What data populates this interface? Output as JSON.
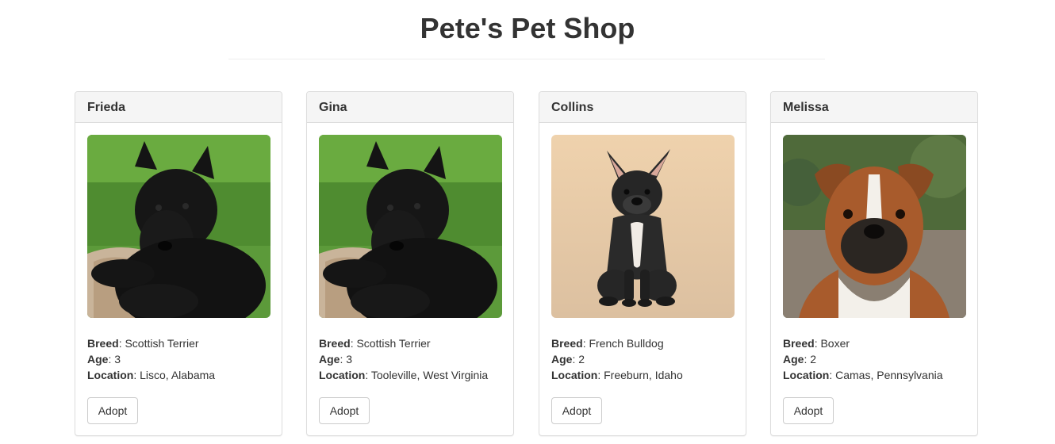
{
  "header": {
    "title": "Pete's Pet Shop"
  },
  "labels": {
    "breed": "Breed",
    "age": "Age",
    "location": "Location",
    "separator": ":"
  },
  "pets": [
    {
      "name": "Frieda",
      "breed": "Scottish Terrier",
      "age": "3",
      "location": "Lisco, Alabama",
      "adopt_label": "Adopt",
      "photo_icon": "scottish-terrier-photo"
    },
    {
      "name": "Gina",
      "breed": "Scottish Terrier",
      "age": "3",
      "location": "Tooleville, West Virginia",
      "adopt_label": "Adopt",
      "photo_icon": "scottish-terrier-photo"
    },
    {
      "name": "Collins",
      "breed": "French Bulldog",
      "age": "2",
      "location": "Freeburn, Idaho",
      "adopt_label": "Adopt",
      "photo_icon": "french-bulldog-photo"
    },
    {
      "name": "Melissa",
      "breed": "Boxer",
      "age": "2",
      "location": "Camas, Pennsylvania",
      "adopt_label": "Adopt",
      "photo_icon": "boxer-photo"
    }
  ],
  "colors": {
    "title": "#333333",
    "panel_heading_bg": "#f5f5f5",
    "panel_border": "#dddddd",
    "button_border": "#cccccc"
  }
}
